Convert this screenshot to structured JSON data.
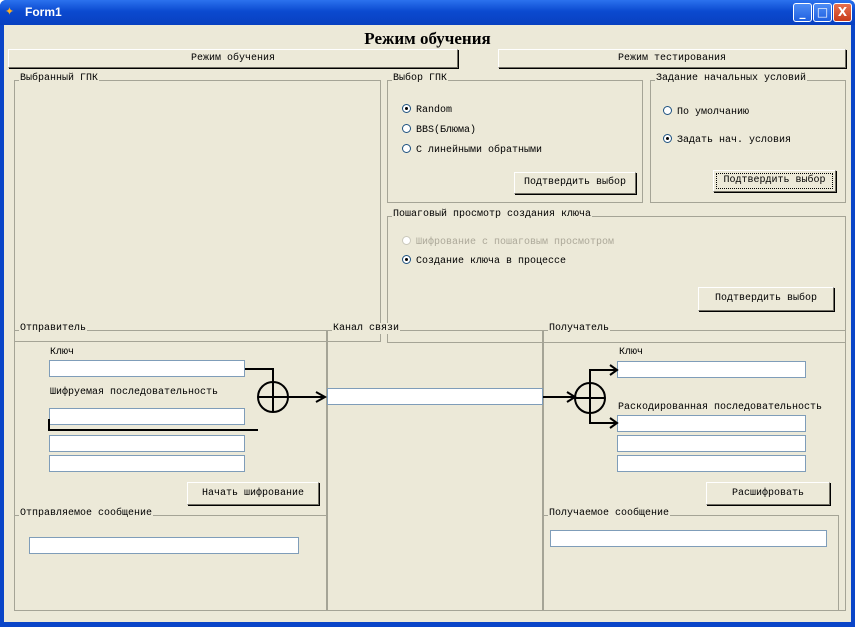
{
  "window": {
    "title": "Form1",
    "icon": "app-icon",
    "controls": {
      "minimize": "_",
      "maximize": "□",
      "close": "X"
    }
  },
  "heading": "Режим обучения",
  "mode_buttons": {
    "learning": "Режим обучения",
    "testing": "Режим тестирования"
  },
  "selected_gpk": {
    "title": "Выбранный ГПК"
  },
  "gpk_choice": {
    "title": "Выбор ГПК",
    "options": [
      "Random",
      "BBS(Блюма)",
      "С линейными обратными"
    ],
    "selected": "Random",
    "confirm": "Подтвердить выбор"
  },
  "initial_conditions": {
    "title": "Задание начальных условий",
    "options": [
      "По умолчанию",
      "Задать нач. условия"
    ],
    "selected": "Задать нач. условия",
    "confirm": "Подтвердить выбор"
  },
  "stepwise": {
    "title": "Пошаговый просмотр создания ключа",
    "options": [
      "Шифрование с пошаговым просмотром",
      "Создание ключа в процессе"
    ],
    "selected": "Создание ключа в процессе",
    "disabled": "Шифрование с пошаговым просмотром",
    "confirm": "Подтвердить выбор"
  },
  "sender": {
    "title": "Отправитель",
    "key_label": "Ключ",
    "seq_label": "Шифруемая последовательность",
    "encrypt_button": "Начать шифрование",
    "message_title": "Отправляемое сообщение"
  },
  "channel": {
    "title": "Канал связи"
  },
  "receiver": {
    "title": "Получатель",
    "key_label": "Ключ",
    "seq_label": "Раскодированная последовательность",
    "decrypt_button": "Расшифровать",
    "message_title": "Получаемое сообщение"
  }
}
